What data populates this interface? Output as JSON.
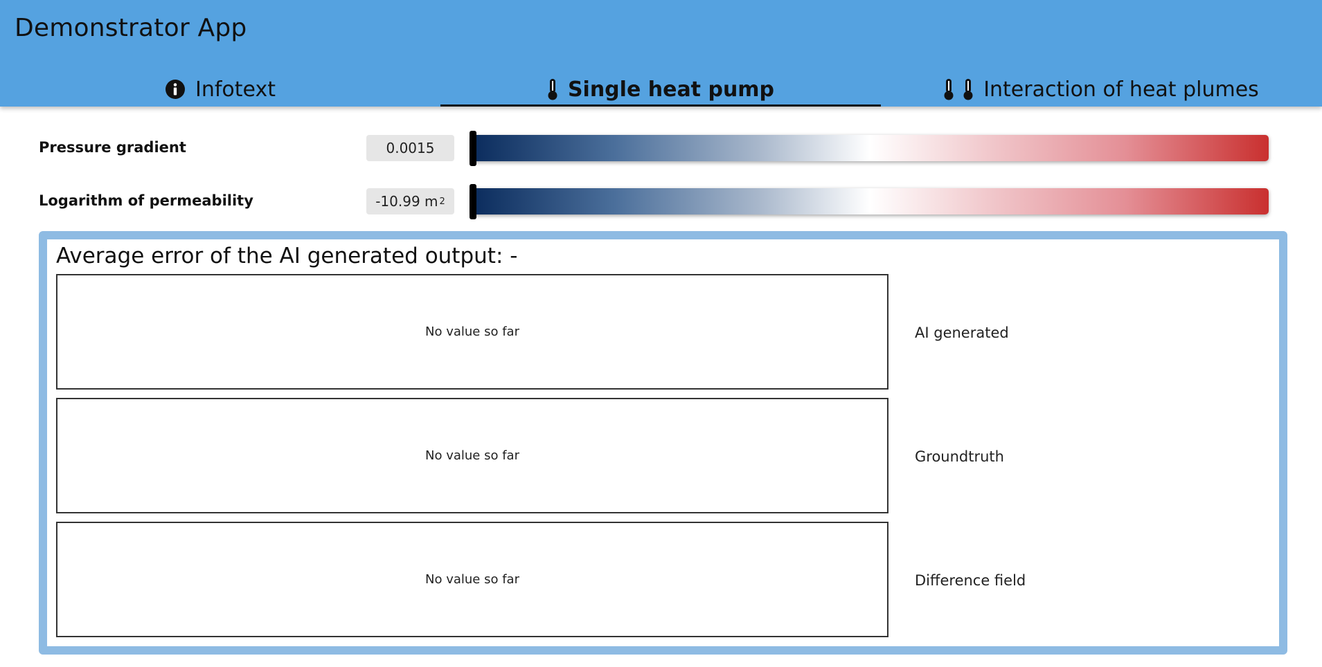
{
  "app": {
    "title": "Demonstrator App"
  },
  "tabs": [
    {
      "label": "Infotext",
      "icon": "info-icon",
      "active": false
    },
    {
      "label": "Single heat pump",
      "icon": "thermometer-icon",
      "active": true
    },
    {
      "label": "Interaction of heat plumes",
      "icon": "thermometer-pair-icon",
      "active": false
    }
  ],
  "params": {
    "pressure": {
      "label": "Pressure gradient",
      "value": "0.0015",
      "slider_position": 0.0
    },
    "permeability": {
      "label": "Logarithm of permeability",
      "value": "-10.99 m",
      "unit_exponent": "2",
      "slider_position": 0.0
    }
  },
  "results": {
    "avg_error": "Average error of the AI generated output: -",
    "plots": [
      {
        "placeholder": "No value so far",
        "label": "AI generated"
      },
      {
        "placeholder": "No value so far",
        "label": "Groundtruth"
      },
      {
        "placeholder": "No value so far",
        "label": "Difference field"
      }
    ]
  },
  "colors": {
    "header": "#55a2e0",
    "panel_border": "#8ebbe3",
    "slider_low": "#0a2b5c",
    "slider_mid": "#ffffff",
    "slider_high": "#c9302f"
  }
}
